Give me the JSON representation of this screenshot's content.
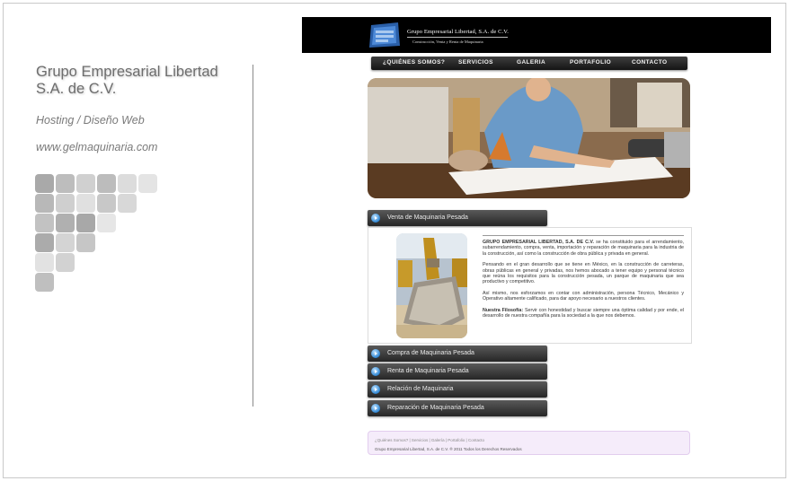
{
  "sidebar": {
    "title_line1": "Grupo Empresarial Libertad",
    "title_line2": "S.A. de C.V.",
    "services": "Hosting / Diseño Web",
    "url": "www.gelmaquinaria.com"
  },
  "site": {
    "logo_name": "Grupo Empresarial Libertad, S.A. de C.V.",
    "logo_tagline": "Construcción,   Venta   y   Renta   de   Maquinaria",
    "nav": [
      "¿QUIÉNES SOMOS?",
      "SERVICIOS",
      "GALERIA",
      "PORTAFOLIO",
      "CONTACTO"
    ],
    "accordion": [
      "Venta de Maquinaria Pesada",
      "Compra de Maquinaria Pesada",
      "Renta de Maquinaria Pesada",
      "Relación de Maquinaria",
      "Reparación de Maquinaria Pesada"
    ],
    "content": {
      "p1_bold": "GRUPO EMPRESARIAL LIBERTAD, S.A. DE C.V.",
      "p1_rest": " se ha constituido para el arrendamiento, subarrendamiento, compra, venta, importación y reparación de maquinaria para la industria de la construcción, así como la construcción de obra pública y privada en general.",
      "p2": "Pensando en el gran desarrollo que se tiene en México, en la construcción de carreteras, obras públicas en general y privadas, nos hemos abocado a tener equipo y personal técnico que reúna los requisitos para la construcción pesada, un parque de maquinaria que sea productivo y competitivo.",
      "p3": "Así mismo, nos esforzamos en contar con administración, persona Técnico, Mecánico y Operativo altamente calificado, para dar apoyo necesario a nuestros clientes.",
      "p4_bold": "Nuestra Filosofía:",
      "p4_rest": " Servir con honestidad y buscar siempre una óptima calidad y por ende, el desarrollo de nuestra compañía para la sociedad a la que nos debemos."
    },
    "footer": {
      "links": "¿Quiénes Somos? | Servicios | Galería | Portafolio | Contacto",
      "copyright": "Grupo Empresarial Libertad, S.A. de C.V. ® 2011 Todos los Derechos Reservados"
    }
  },
  "colors": {
    "header_bg": "#000000",
    "accent_blue": "#2e86d4",
    "footer_bg": "#f5ecfa"
  }
}
